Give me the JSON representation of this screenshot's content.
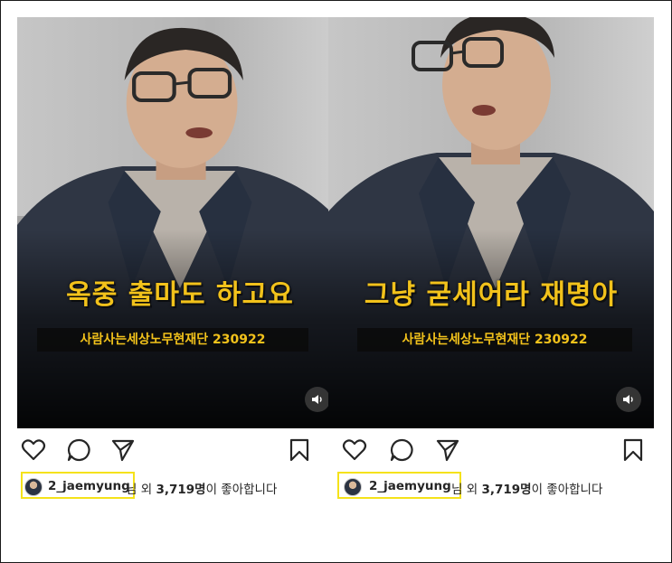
{
  "posts": [
    {
      "caption": "옥중 출마도 하고요",
      "subtitle": "사람사는세상노무현재단 230922",
      "username": "2_jaemyung",
      "honorific": "님",
      "likes_prefix": "외",
      "likes_count": "3,719명",
      "likes_suffix": "이 좋아합니다"
    },
    {
      "caption": "그냥 굳세어라 재명아",
      "subtitle": "사람사는세상노무현재단 230922",
      "username": "2_jaemyung",
      "honorific": "님",
      "likes_prefix": "외",
      "likes_count": "3,719명",
      "likes_suffix": "이 좋아합니다"
    }
  ],
  "icons": [
    "heart-icon",
    "comment-icon",
    "share-icon",
    "bookmark-icon",
    "speaker-icon"
  ],
  "colors": {
    "caption": "#f2c21b",
    "highlight": "#f5e21a",
    "text": "#262626"
  }
}
